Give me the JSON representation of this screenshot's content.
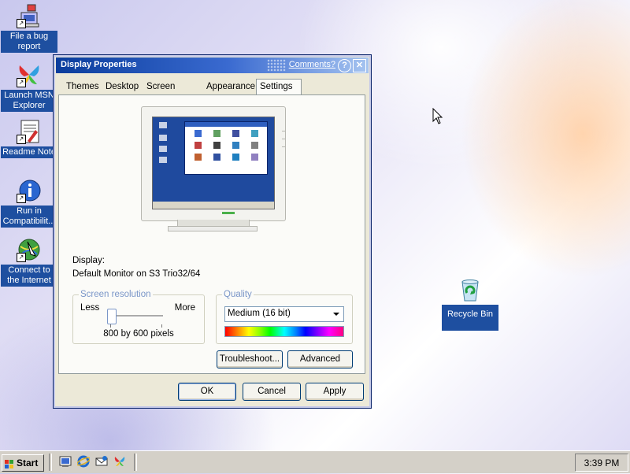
{
  "desktop": {
    "icons": [
      {
        "label": "File a bug report"
      },
      {
        "label": "Launch MSN Explorer"
      },
      {
        "label": "Readme Note"
      },
      {
        "label": "Run in Compatibilit..."
      },
      {
        "label": "Connect to the Internet"
      },
      {
        "label": "Recycle Bin"
      }
    ]
  },
  "dialog": {
    "title": "Display Properties",
    "comments_link": "Comments?",
    "help_glyph": "?",
    "close_glyph": "✕",
    "tabs": [
      {
        "label": "Themes"
      },
      {
        "label": "Desktop"
      },
      {
        "label": "Screen Saver"
      },
      {
        "label": "Appearance"
      },
      {
        "label": "Settings"
      }
    ],
    "active_tab": "Settings",
    "display_label": "Display:",
    "display_value": "Default Monitor on S3 Trio32/64",
    "resolution": {
      "group_label": "Screen resolution",
      "less": "Less",
      "more": "More",
      "value": "800 by 600 pixels",
      "slider_level": 0.0
    },
    "quality": {
      "group_label": "Quality",
      "selected": "Medium (16 bit)"
    },
    "buttons": {
      "troubleshoot": "Troubleshoot...",
      "advanced": "Advanced",
      "ok": "OK",
      "cancel": "Cancel",
      "apply": "Apply"
    }
  },
  "taskbar": {
    "start_label": "Start",
    "clock": "3:39 PM"
  },
  "colors": {
    "title_bar": "#0a3d9c",
    "desktop_label_bg": "#1e4fa0",
    "dialog_bg": "#ece9d8",
    "group_label": "#7a96c8"
  }
}
